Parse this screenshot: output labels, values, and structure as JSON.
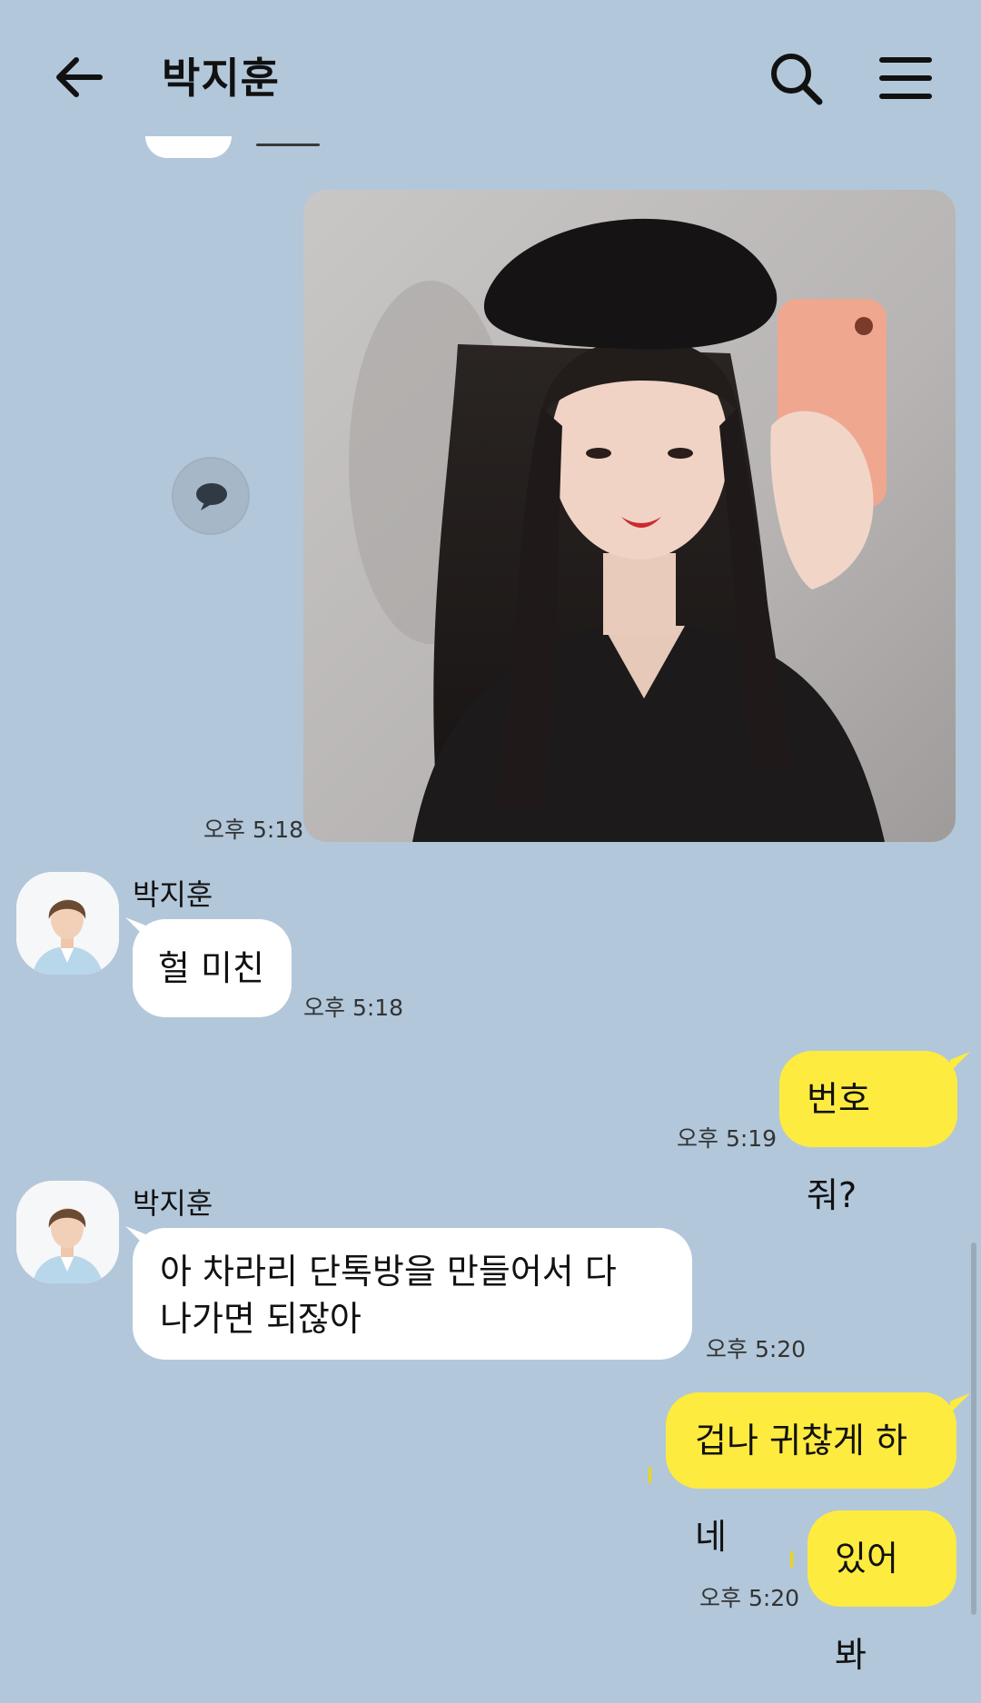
{
  "header": {
    "title": "박지훈",
    "back_icon": "arrow-left-icon",
    "search_icon": "search-icon",
    "menu_icon": "menu-icon"
  },
  "colors": {
    "background": "#b2c7da",
    "outgoing_bubble": "#fdeb3f",
    "incoming_bubble": "#ffffff"
  },
  "messages": [
    {
      "type": "image",
      "direction": "out",
      "description_icon": "photo",
      "time": "오후 5:18"
    },
    {
      "type": "text",
      "direction": "in",
      "sender": "박지훈",
      "text": "헐 미친",
      "time": "오후 5:18"
    },
    {
      "type": "text",
      "direction": "out",
      "text": "번호 줘?",
      "time": "오후 5:19"
    },
    {
      "type": "text",
      "direction": "in",
      "sender": "박지훈",
      "lines": [
        "아 차라리 단톡방을 만들어서 다",
        "나가면 되잖아"
      ],
      "time": "오후 5:20"
    },
    {
      "type": "text",
      "direction": "out",
      "text": "겁나 귀찮게 하네",
      "time": ""
    },
    {
      "type": "text",
      "direction": "out",
      "text": "있어봐",
      "time": "오후 5:20"
    }
  ]
}
